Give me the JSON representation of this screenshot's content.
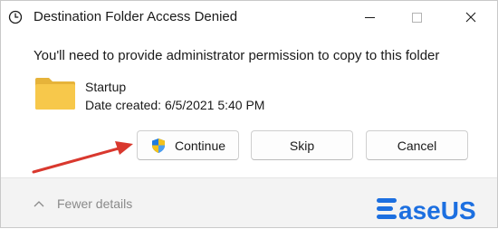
{
  "window": {
    "title": "Destination Folder Access Denied",
    "app_icon": "clock-icon",
    "controls": [
      "minimize-icon",
      "maximize-icon",
      "close-icon"
    ]
  },
  "message": "You'll need to provide administrator permission to copy to this folder",
  "file": {
    "icon": "folder-icon",
    "name": "Startup",
    "date_created": "Date created: 6/5/2021 5:40 PM"
  },
  "buttons": {
    "continue_label": "Continue",
    "continue_icon": "uac-shield-icon",
    "skip_label": "Skip",
    "cancel_label": "Cancel"
  },
  "footer": {
    "details_label": "Fewer details",
    "details_icon": "chevron-up-icon"
  },
  "watermark": {
    "text": "EaseUS",
    "color": "#1c6fe0"
  },
  "annotation": {
    "arrow_color": "#d9382e",
    "arrow_target": "continue-button"
  },
  "colors": {
    "folder": "#f7c84b",
    "shield_blue": "#1e7be0",
    "shield_yellow": "#f3c11b"
  }
}
